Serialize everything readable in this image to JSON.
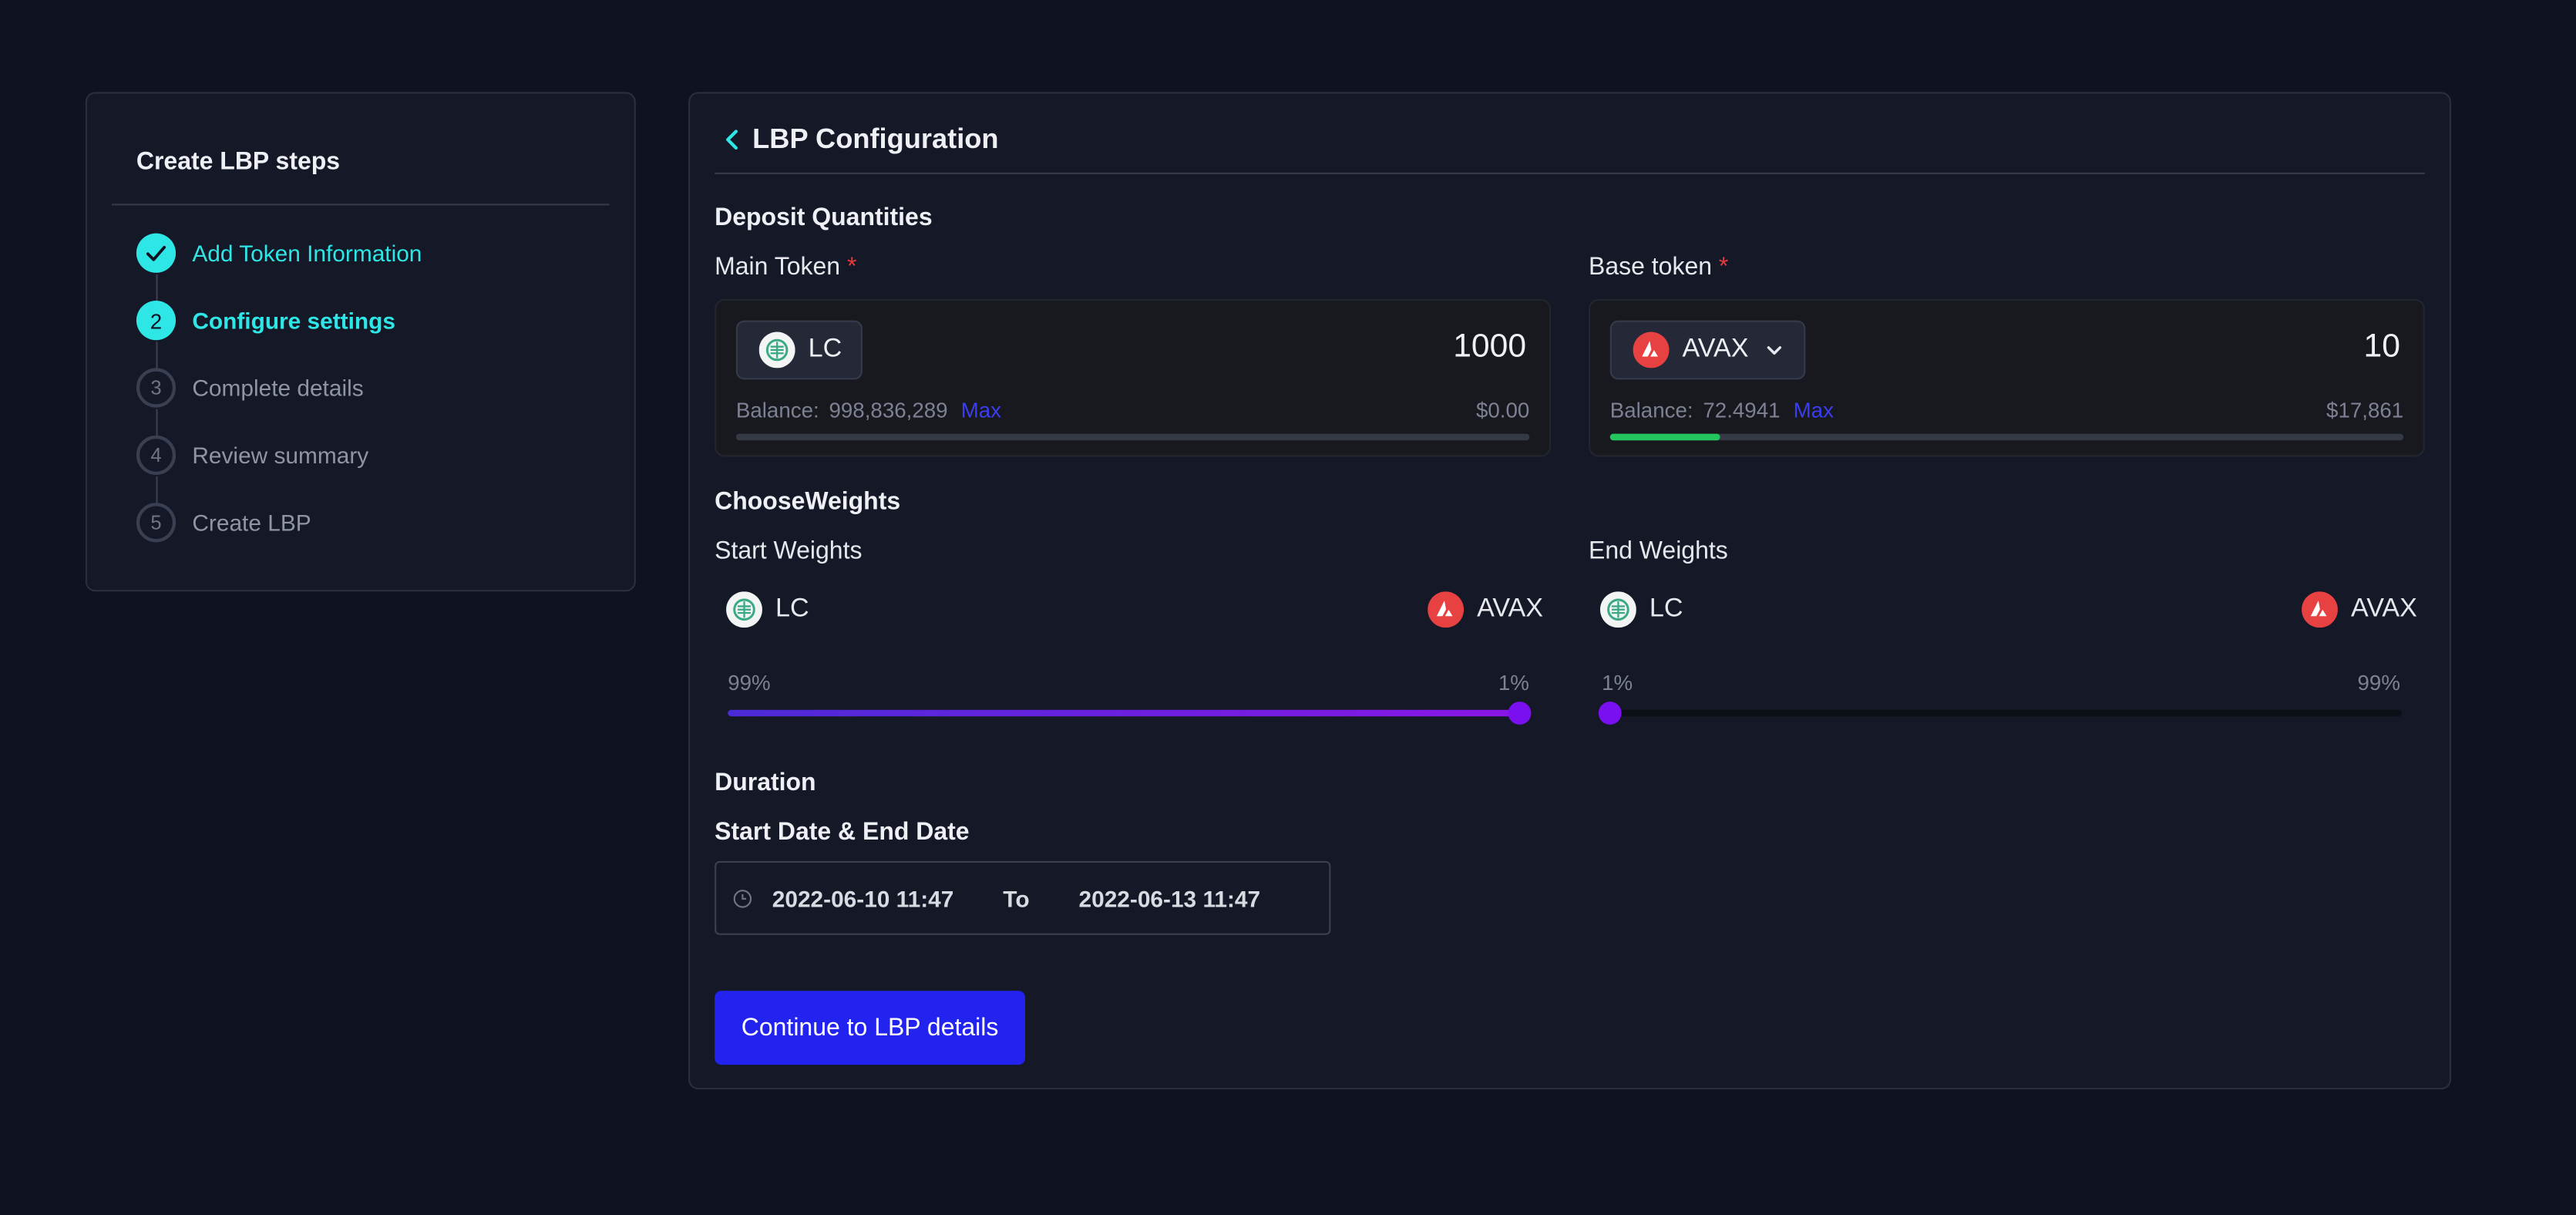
{
  "steps": {
    "title": "Create LBP steps",
    "items": [
      {
        "number": "",
        "label": "Add Token Information",
        "status": "done"
      },
      {
        "number": "2",
        "label": "Configure settings",
        "status": "active"
      },
      {
        "number": "3",
        "label": "Complete details",
        "status": "todo"
      },
      {
        "number": "4",
        "label": "Review summary",
        "status": "todo"
      },
      {
        "number": "5",
        "label": "Create LBP",
        "status": "todo"
      }
    ]
  },
  "main": {
    "title": "LBP Configuration",
    "deposit": {
      "section_title": "Deposit Quantities",
      "main_token": {
        "label": "Main Token",
        "required_mark": "*",
        "symbol": "LC",
        "amount": "1000",
        "balance_label": "Balance:",
        "balance": "998,836,289",
        "max_label": "Max",
        "usd_value": "$0.00",
        "balance_fraction": 0
      },
      "base_token": {
        "label": "Base token",
        "required_mark": "*",
        "symbol": "AVAX",
        "amount": "10",
        "balance_label": "Balance:",
        "balance": "72.4941",
        "max_label": "Max",
        "usd_value": "$17,861",
        "balance_fraction": 0.138
      }
    },
    "weights": {
      "section_title": "ChooseWeights",
      "start": {
        "label": "Start Weights",
        "left_token": "LC",
        "right_token": "AVAX",
        "left_pct": "99%",
        "right_pct": "1%",
        "value": 99
      },
      "end": {
        "label": "End Weights",
        "left_token": "LC",
        "right_token": "AVAX",
        "left_pct": "1%",
        "right_pct": "99%",
        "value": 1
      }
    },
    "duration": {
      "section_title": "Duration",
      "range_label": "Start Date & End Date",
      "start_date": "2022-06-10 11:47",
      "separator": "To",
      "end_date": "2022-06-13 11:47"
    },
    "continue_label": "Continue to LBP details"
  },
  "colors": {
    "accent": "#2ee6e6",
    "primary_button": "#2323f0",
    "link": "#3b3ef0",
    "required": "#e53b3b",
    "slider": "#7a10f0",
    "balance_bar": "#22c55e",
    "avax": "#e84142"
  },
  "icons": {
    "back": "chevron-left-icon",
    "lc": "lc-token-icon",
    "avax": "avax-token-icon",
    "dropdown": "chevron-down-icon",
    "clock": "clock-icon",
    "step_done": "check-icon"
  }
}
